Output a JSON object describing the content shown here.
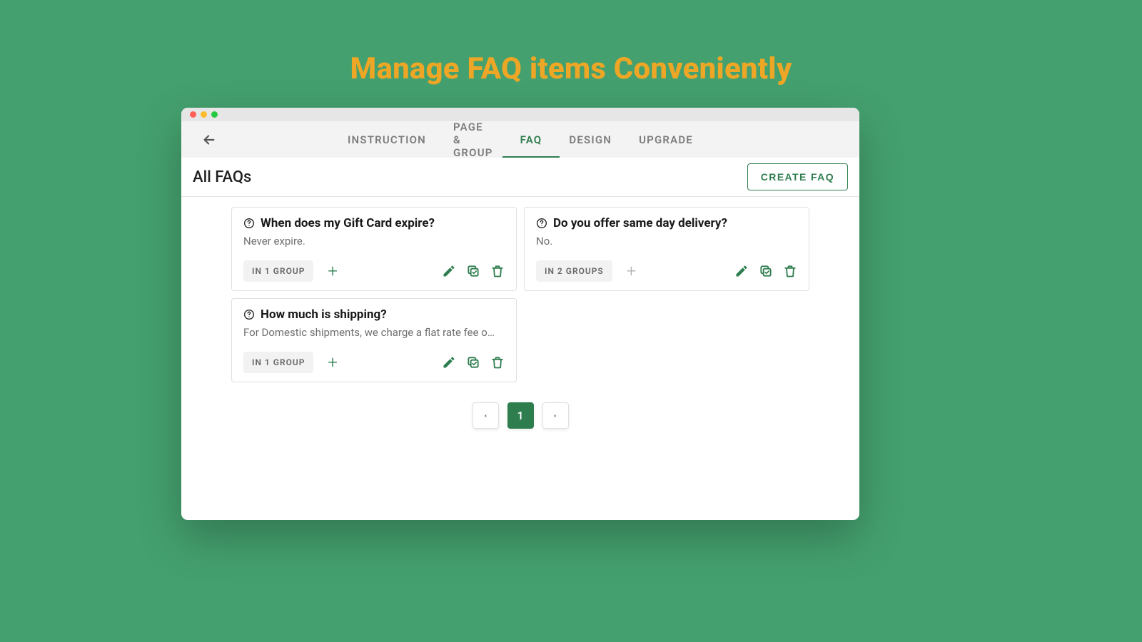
{
  "hero_title": "Manage FAQ items Conveniently",
  "nav": {
    "tabs": [
      "INSTRUCTION",
      "PAGE & GROUP",
      "FAQ",
      "DESIGN",
      "UPGRADE"
    ],
    "active_index": 2
  },
  "subheader": {
    "title": "All FAQs",
    "create_label": "CREATE FAQ"
  },
  "faqs": [
    {
      "question": "When does my Gift Card expire?",
      "answer": "Never expire.",
      "group_label": "IN 1 GROUP",
      "plus_enabled": true
    },
    {
      "question": "Do you offer same day delivery?",
      "answer": "No.",
      "group_label": "IN 2 GROUPS",
      "plus_enabled": false
    },
    {
      "question": "How much is shipping?",
      "answer": "For Domestic shipments, we charge a flat rate fee o…",
      "group_label": "IN 1 GROUP",
      "plus_enabled": true
    }
  ],
  "pagination": {
    "current": "1"
  }
}
